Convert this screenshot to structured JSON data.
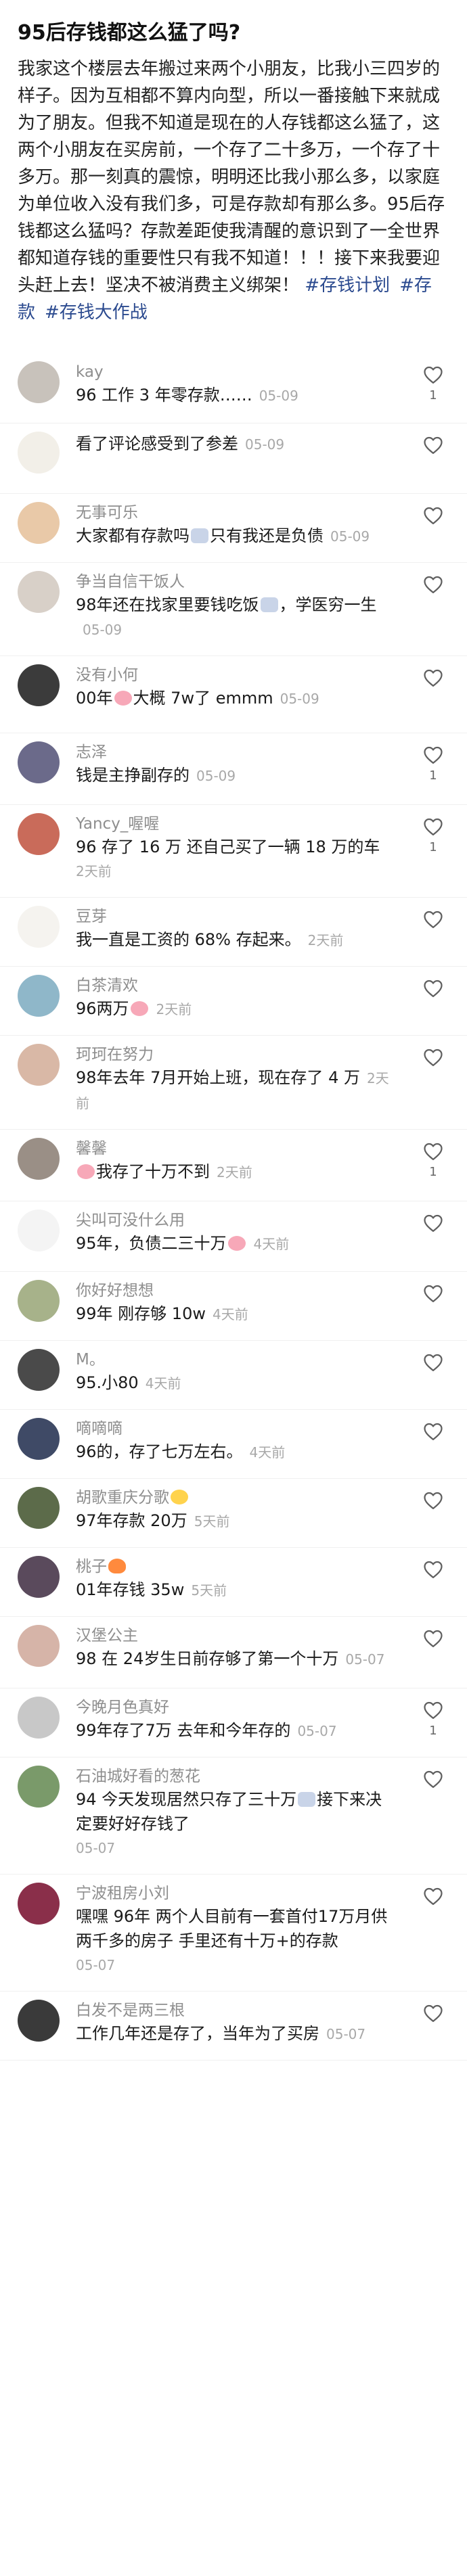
{
  "post": {
    "title": "95后存钱都这么猛了吗?",
    "body": "我家这个楼层去年搬过来两个小朋友，比我小三四岁的样子。因为互相都不算内向型，所以一番接触下来就成为了朋友。但我不知道是现在的人存钱都这么猛了，这两个小朋友在买房前，一个存了二十多万，一个存了十多万。那一刻真的震惊，明明还比我小那么多，以家庭为单位收入没有我们多，可是存款却有那么多。95后存钱都这么猛吗？存款差距使我清醒的意识到了一全世界都知道存钱的重要性只有我不知道！！！接下来我要迎头赶上去！坚决不被消费主义绑架！",
    "tags": [
      "#存钱计划",
      "#存款",
      "#存钱大作战"
    ]
  },
  "comments": [
    {
      "name": "kay",
      "text": "96 工作 3 年零存款……",
      "time": "05-09",
      "likes": "1",
      "avatar_color": "#c8c2bb"
    },
    {
      "name": "",
      "text": "看了评论感受到了参差",
      "time": "05-09",
      "likes": "",
      "avatar_color": "#f2efe8"
    },
    {
      "name": "无事可乐",
      "text_parts": [
        "大家都有存款吗",
        "只有我还是负债"
      ],
      "emoji": "bank",
      "time": "05-09",
      "likes": "",
      "avatar_color": "#e9c9a8"
    },
    {
      "name": "争当自信干饭人",
      "text_parts": [
        "98年还在找家里要钱吃饭",
        "，学医穷一生"
      ],
      "emoji": "bank",
      "time": "05-09",
      "likes": "",
      "avatar_color": "#d8d0c8"
    },
    {
      "name": "没有小何",
      "text_parts": [
        "00年",
        "大概 7w了 emmm"
      ],
      "emoji": "pig",
      "time": "05-09",
      "likes": "",
      "avatar_color": "#3b3b3b"
    },
    {
      "name": "志泽",
      "text": "钱是主挣副存的",
      "time": "05-09",
      "likes": "1",
      "avatar_color": "#6b6a8a"
    },
    {
      "name": "Yancy_喔喔",
      "text": "96 存了 16 万 还自己买了一辆 18 万的车",
      "time": "2天前",
      "likes": "1",
      "avatar_color": "#c96b5a"
    },
    {
      "name": "豆芽",
      "text": "我一直是工资的 68% 存起来。",
      "time": "2天前",
      "likes": "",
      "avatar_color": "#f5f3ef"
    },
    {
      "name": "白茶清欢",
      "text_parts": [
        "96两万",
        ""
      ],
      "emoji": "pig",
      "time": "2天前",
      "likes": "",
      "avatar_color": "#8fb7c9"
    },
    {
      "name": "珂珂在努力",
      "text": "98年去年 7月开始上班，现在存了 4 万",
      "time": "2天前",
      "likes": "",
      "avatar_color": "#d9b8a6"
    },
    {
      "name": "馨馨",
      "text_parts": [
        "",
        "我存了十万不到"
      ],
      "emoji": "pig",
      "time": "2天前",
      "likes": "1",
      "avatar_color": "#9a8f86"
    },
    {
      "name": "尖叫可没什么用",
      "text_parts": [
        "95年，负债二三十万",
        ""
      ],
      "emoji": "pig",
      "time": "4天前",
      "likes": "",
      "avatar_color": "#f4f4f4"
    },
    {
      "name": "你好好想想",
      "text": "99年  刚存够 10w",
      "time": "4天前",
      "likes": "",
      "avatar_color": "#a7b28a"
    },
    {
      "name": "M。",
      "text": "95.小80",
      "time": "4天前",
      "likes": "",
      "avatar_color": "#4a4a4a"
    },
    {
      "name": "嘀嘀嘀",
      "text": "96的，存了七万左右。",
      "time": "4天前",
      "likes": "",
      "avatar_color": "#3f4a66"
    },
    {
      "name": "胡歌重庆分歌",
      "name_emoji": "smile",
      "text": "97年存款 20万",
      "time": "5天前",
      "likes": "",
      "avatar_color": "#5c6b4a"
    },
    {
      "name": "桃子",
      "name_emoji": "fire",
      "text": "01年存钱 35w",
      "time": "5天前",
      "likes": "",
      "avatar_color": "#5a4a5c"
    },
    {
      "name": "汉堡公主",
      "text": "98  在 24岁生日前存够了第一个十万",
      "time": "05-07",
      "likes": "",
      "avatar_color": "#d6b4a8"
    },
    {
      "name": "今晚月色真好",
      "text": "99年存了7万 去年和今年存的",
      "time": "05-07",
      "likes": "1",
      "avatar_color": "#c8c8c8"
    },
    {
      "name": "石油城好看的葱花",
      "text_parts": [
        "94 今天发现居然只存了三十万",
        "接下来决定要好好存钱了"
      ],
      "emoji": "bank",
      "time": "05-07",
      "likes": "",
      "avatar_color": "#7a9a6a"
    },
    {
      "name": "宁波租房小刘",
      "text": "嘿嘿 96年 两个人目前有一套首付17万月供两千多的房子 手里还有十万+的存款",
      "time": "05-07",
      "likes": "",
      "avatar_color": "#8a2f4a"
    },
    {
      "name": "白发不是两三根",
      "text": "工作几年还是存了，当年为了买房",
      "time": "05-07",
      "likes": "",
      "avatar_color": "#3a3a3a"
    }
  ]
}
